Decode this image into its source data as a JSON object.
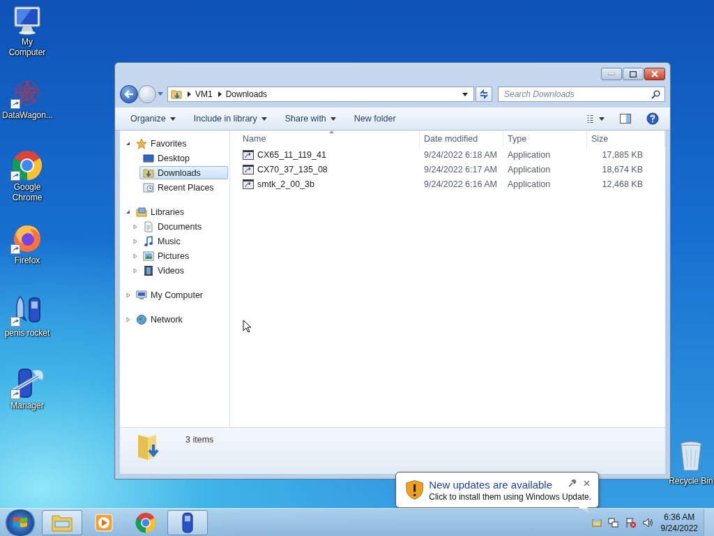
{
  "desktop_icons": [
    {
      "label": "My Computer",
      "kind": "computer",
      "shortcut": false
    },
    {
      "label": "DataWagon...",
      "kind": "network-art",
      "shortcut": true
    },
    {
      "label": "Google Chrome",
      "kind": "chrome",
      "shortcut": true
    },
    {
      "label": "Firefox",
      "kind": "firefox",
      "shortcut": true
    },
    {
      "label": "penis rocket",
      "kind": "rocket",
      "shortcut": true
    },
    {
      "label": "Manager",
      "kind": "manager",
      "shortcut": true
    }
  ],
  "recycle_bin": {
    "label": "Recycle Bin"
  },
  "explorer": {
    "breadcrumb": [
      "VM1",
      "Downloads"
    ],
    "search": {
      "placeholder": "Search Downloads"
    },
    "toolbar": [
      {
        "label": "Organize",
        "dropdown": true
      },
      {
        "label": "Include in library",
        "dropdown": true
      },
      {
        "label": "Share with",
        "dropdown": true
      },
      {
        "label": "New folder",
        "dropdown": false
      }
    ],
    "nav": [
      {
        "label": "Favorites",
        "kind": "star",
        "expanded": true,
        "selected": false,
        "children": [
          {
            "label": "Desktop",
            "kind": "desktop",
            "selected": false
          },
          {
            "label": "Downloads",
            "kind": "downloads",
            "selected": true
          },
          {
            "label": "Recent Places",
            "kind": "recent",
            "selected": false
          }
        ]
      },
      {
        "label": "Libraries",
        "kind": "library",
        "expanded": true,
        "selected": false,
        "children": [
          {
            "label": "Documents",
            "kind": "document",
            "expanded": false,
            "selected": false
          },
          {
            "label": "Music",
            "kind": "music",
            "expanded": false,
            "selected": false
          },
          {
            "label": "Pictures",
            "kind": "picture",
            "expanded": false,
            "selected": false
          },
          {
            "label": "Videos",
            "kind": "video",
            "expanded": false,
            "selected": false
          }
        ]
      },
      {
        "label": "My Computer",
        "kind": "computer",
        "expanded": false,
        "selected": false
      },
      {
        "label": "Network",
        "kind": "network",
        "expanded": false,
        "selected": false
      }
    ],
    "columns": [
      {
        "label": "Name",
        "sorted": true
      },
      {
        "label": "Date modified",
        "sorted": false
      },
      {
        "label": "Type",
        "sorted": false
      },
      {
        "label": "Size",
        "sorted": false
      }
    ],
    "rows": [
      {
        "name": "CX65_11_119_41",
        "date": "9/24/2022 6:18 AM",
        "type": "Application",
        "size": "17,885 KB"
      },
      {
        "name": "CX70_37_135_08",
        "date": "9/24/2022 6:17 AM",
        "type": "Application",
        "size": "18,674 KB"
      },
      {
        "name": "smtk_2_00_3b",
        "date": "9/24/2022 6:16 AM",
        "type": "Application",
        "size": "12,468 KB"
      }
    ],
    "status": "3 items"
  },
  "notification": {
    "title": "New updates are available",
    "text": "Click to install them using Windows Update."
  },
  "taskbar": {
    "items": [
      {
        "kind": "explorer",
        "running": true
      },
      {
        "kind": "media",
        "running": false
      },
      {
        "kind": "chrome",
        "running": false
      },
      {
        "kind": "phone",
        "running": true
      }
    ],
    "time": "6:36 AM",
    "date": "9/24/2022"
  }
}
